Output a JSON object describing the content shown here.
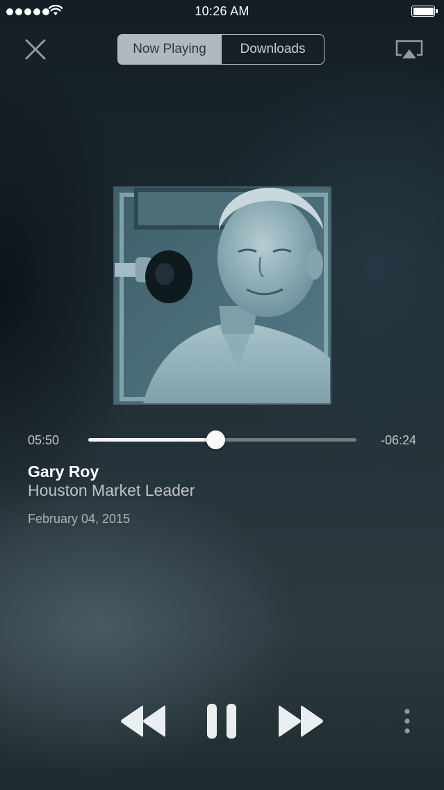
{
  "status_bar": {
    "time": "10:26 AM",
    "signal_dots": 5,
    "icons": [
      "signal-dots",
      "wifi-icon",
      "battery-icon"
    ]
  },
  "header": {
    "close_icon": "close-icon",
    "tabs": [
      {
        "label": "Now Playing",
        "active": true
      },
      {
        "label": "Downloads",
        "active": false
      }
    ],
    "airplay_icon": "airplay-icon"
  },
  "player": {
    "elapsed": "05:50",
    "remaining": "-06:24",
    "progress": 0.475
  },
  "episode": {
    "title": "Gary Roy",
    "subtitle": "Houston Market Leader",
    "date": "February 04, 2015"
  },
  "controls": {
    "icons": [
      "rewind-icon",
      "pause-icon",
      "fast-forward-icon",
      "more-vertical-icon"
    ]
  },
  "colors": {
    "background": "#1d2a31",
    "accent": "#ffffff",
    "artwork_tint": "#5f8591"
  }
}
